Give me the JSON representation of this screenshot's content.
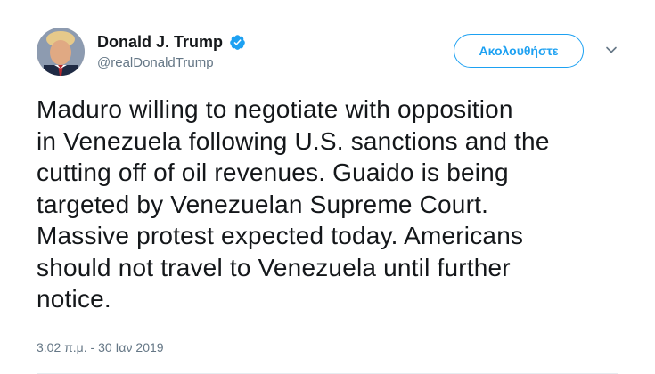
{
  "tweet": {
    "author": {
      "display_name": "Donald J. Trump",
      "handle": "@realDonaldTrump",
      "verified_icon": "verified-badge-icon",
      "avatar_icon": "profile-photo"
    },
    "follow_label": "Ακολουθήστε",
    "menu_icon": "chevron-down-icon",
    "text": "Maduro willing to negotiate with opposition\nin Venezuela following U.S. sanctions and the\ncutting off of oil revenues. Guaido is being\ntargeted by Venezuelan Supreme Court.\nMassive protest expected today. Americans\nshould not travel to Venezuela until further\nnotice.",
    "timestamp": "3:02 π.μ. - 30 Ιαν 2019"
  },
  "colors": {
    "accent": "#1da1f2",
    "text_primary": "#14171a",
    "text_secondary": "#657786",
    "divider": "#e6ecf0"
  }
}
